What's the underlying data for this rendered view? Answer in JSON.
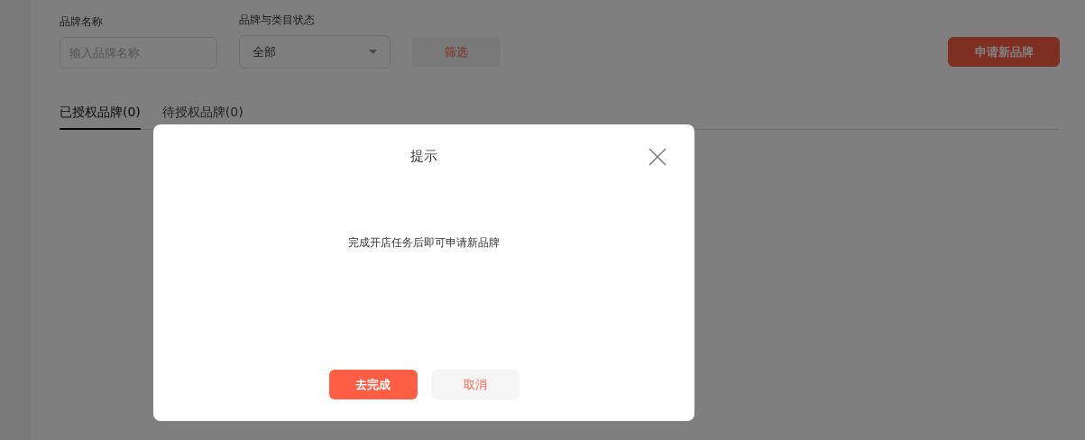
{
  "filters": {
    "brand_name": {
      "label": "品牌名称",
      "placeholder": "输入品牌名称"
    },
    "status": {
      "label": "品牌与类目状态",
      "value": "全部"
    },
    "filter_button": "筛选",
    "apply_button": "申请新品牌"
  },
  "tabs": [
    {
      "label": "已授权品牌(0)",
      "selected": true
    },
    {
      "label": "待授权品牌(0)",
      "selected": false
    }
  ],
  "dialog": {
    "title": "提示",
    "message": "完成开店任务后即可申请新品牌",
    "buttons": [
      {
        "label": "去完成",
        "kind": "primary"
      },
      {
        "label": "取消",
        "kind": "secondary"
      }
    ]
  }
}
